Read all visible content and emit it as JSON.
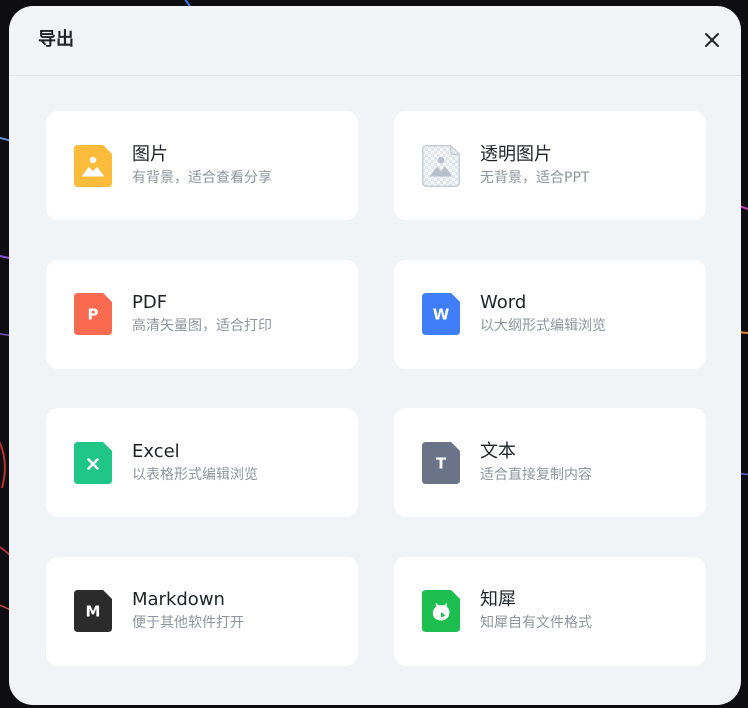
{
  "dialog": {
    "title": "导出",
    "close_icon": "close-icon"
  },
  "options": [
    {
      "title": "图片",
      "desc": "有背景，适合查看分享",
      "icon": "image-file-icon",
      "color": "#FDBB3C"
    },
    {
      "title": "透明图片",
      "desc": "无背景，适合PPT",
      "icon": "transparent-image-file-icon",
      "color": "#C5CCD8"
    },
    {
      "title": "PDF",
      "desc": "高清矢量图，适合打印",
      "icon": "pdf-file-icon",
      "color": "#FA6A50",
      "glyph": "P"
    },
    {
      "title": "Word",
      "desc": "以大纲形式编辑浏览",
      "icon": "word-file-icon",
      "color": "#3F7EF7",
      "glyph": "W"
    },
    {
      "title": "Excel",
      "desc": "以表格形式编辑浏览",
      "icon": "excel-file-icon",
      "color": "#1FC687"
    },
    {
      "title": "文本",
      "desc": "适合直接复制内容",
      "icon": "text-file-icon",
      "color": "#6B7389",
      "glyph": "T"
    },
    {
      "title": "Markdown",
      "desc": "便于其他软件打开",
      "icon": "markdown-file-icon",
      "color": "#2B2B2B",
      "glyph": "M"
    },
    {
      "title": "知犀",
      "desc": "知犀自有文件格式",
      "icon": "zhixi-file-icon",
      "color": "#1CBF4F"
    }
  ]
}
